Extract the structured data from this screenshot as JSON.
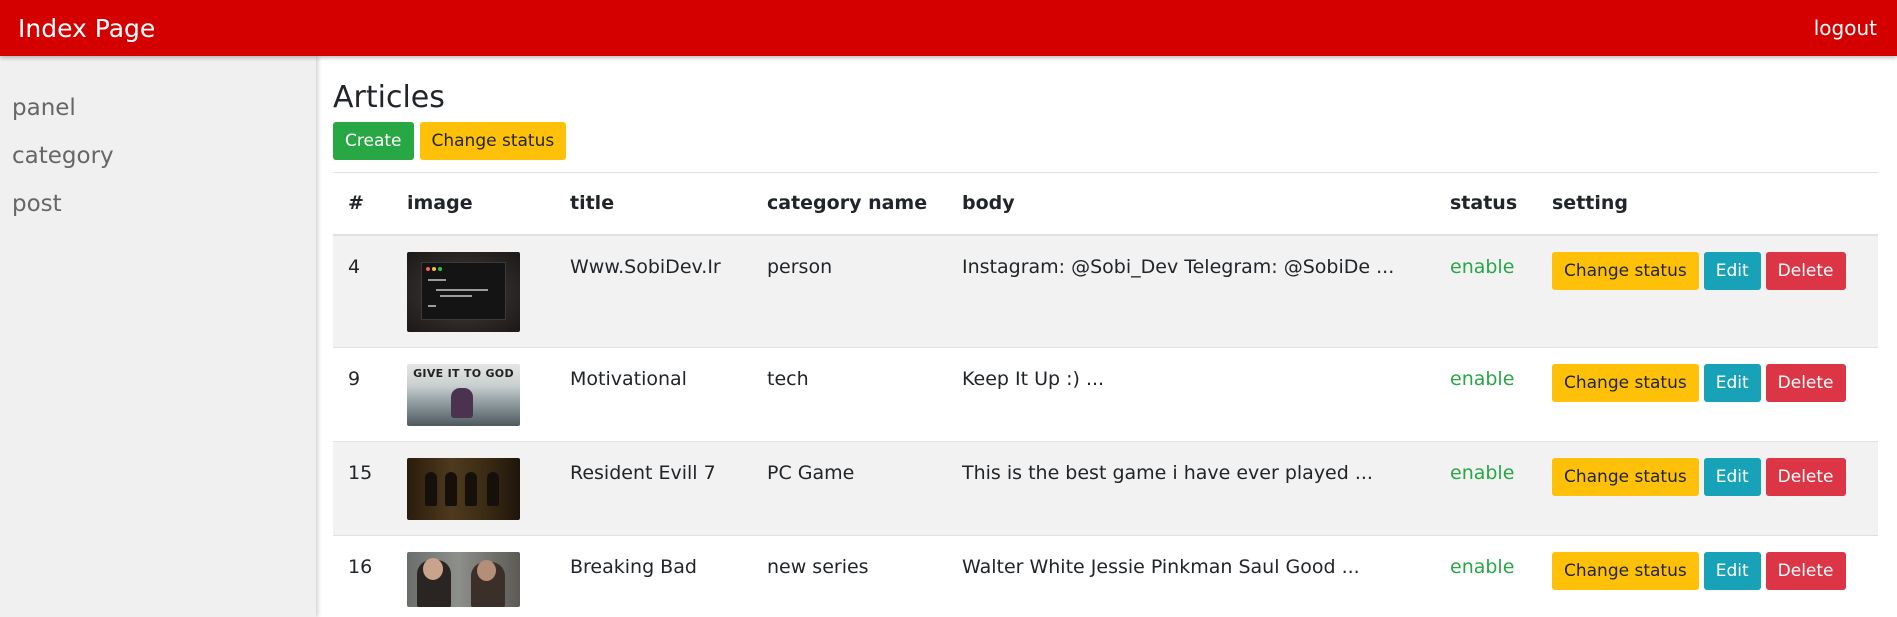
{
  "navbar": {
    "brand": "Index Page",
    "logout": "logout"
  },
  "sidebar": {
    "items": [
      {
        "label": "panel"
      },
      {
        "label": "category"
      },
      {
        "label": "post"
      }
    ]
  },
  "main": {
    "title": "Articles",
    "create_label": "Create",
    "change_status_label": "Change status"
  },
  "table": {
    "headers": [
      "#",
      "image",
      "title",
      "category name",
      "body",
      "status",
      "setting"
    ],
    "rows": [
      {
        "id": "4",
        "image": "code-screen-thumbnail",
        "title": "Www.SobiDev.Ir",
        "category": "person",
        "body": "Instagram: @Sobi_Dev Telegram: @SobiDe ...",
        "status": "enable"
      },
      {
        "id": "9",
        "image": "give-it-to-god-thumbnail",
        "image_caption": "GIVE IT TO GOD",
        "title": "Motivational",
        "category": "tech",
        "body": "Keep It Up :) ...",
        "status": "enable"
      },
      {
        "id": "15",
        "image": "resident-evil-thumbnail",
        "title": "Resident Evill 7",
        "category": "PC Game",
        "body": "This is the best game i have ever played ...",
        "status": "enable"
      },
      {
        "id": "16",
        "image": "breaking-bad-thumbnail",
        "title": "Breaking Bad",
        "category": "new series",
        "body": "Walter White Jessie Pinkman Saul Good ...",
        "status": "enable"
      }
    ],
    "row_actions": {
      "change_status": "Change status",
      "edit": "Edit",
      "delete": "Delete"
    }
  },
  "colors": {
    "navbar": "#d40000",
    "sidebar": "#f0f0f0",
    "success": "#28a745",
    "warning": "#ffc107",
    "info": "#17a2b8",
    "danger": "#dc3545"
  }
}
